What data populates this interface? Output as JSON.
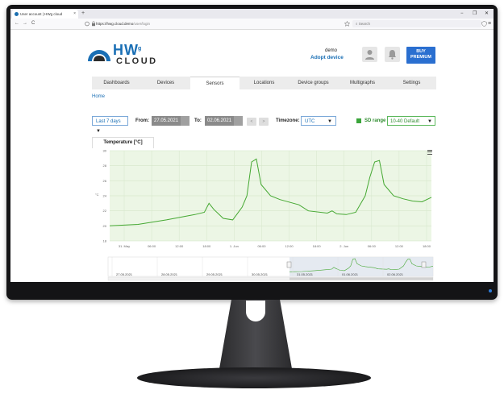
{
  "browser": {
    "tab_title": "User account | HWg cloud",
    "tab_close": "×",
    "new_tab": "+",
    "url_host": "https://hwg.cloud.demo",
    "url_path": "/user/login",
    "search_placeholder": "Search",
    "nav_back": "←",
    "nav_forward": "→",
    "nav_reload": "C",
    "win_min": "−",
    "win_max": "❐",
    "win_close": "✕"
  },
  "header": {
    "logo_hw": "HW",
    "logo_g": "g",
    "logo_cloud": "CLOUD",
    "user_name": "demo",
    "adopt_device": "Adopt device",
    "buy_line1": "BUY",
    "buy_line2": "PREMIUM"
  },
  "nav": {
    "items": [
      "Dashboards",
      "Devices",
      "Sensors",
      "Locations",
      "Device groups",
      "Multigraphs",
      "Settings"
    ],
    "active": "Sensors"
  },
  "breadcrumb": "Home",
  "filters": {
    "range": "Last 7 days",
    "from_label": "From:",
    "from_value": "27.05.2021",
    "to_label": "To:",
    "to_value": "02.06.2021",
    "prev": "<",
    "next": ">",
    "timezone_label": "Timezone:",
    "timezone_value": "UTC",
    "sd_label": "SD range",
    "sd_value": "10-40 Default"
  },
  "chart_tab": "Temperature [°C]",
  "colors": {
    "accent": "#1a6fb5",
    "line": "#45a832",
    "plot_bg": "#ecf6e5",
    "buy": "#2a6fd0"
  },
  "chart_data": {
    "type": "line",
    "ylabel": "°C",
    "ylim": [
      18,
      30
    ],
    "yticks": [
      18,
      20,
      22,
      24,
      26,
      28,
      30
    ],
    "xticks": [
      "31. May",
      "06:00",
      "12:00",
      "18:00",
      "1. Jun",
      "06:00",
      "12:00",
      "18:00",
      "2. Jun",
      "06:00",
      "12:00",
      "18:00"
    ],
    "grid": true,
    "legend": "none",
    "series": [
      {
        "x": [
          0,
          6,
          12,
          18,
          20,
          21,
          22,
          24,
          26,
          28,
          29,
          30,
          31,
          32,
          34,
          36,
          40,
          42,
          46,
          47,
          48,
          50,
          52,
          54,
          55,
          56,
          57,
          58,
          60,
          62,
          64,
          66,
          68
        ],
        "y": [
          20.0,
          20.2,
          20.8,
          21.5,
          21.8,
          23.0,
          22.2,
          21.0,
          20.8,
          22.5,
          24.0,
          28.5,
          28.9,
          25.5,
          24.0,
          23.5,
          22.8,
          22.0,
          21.7,
          22.0,
          21.6,
          21.5,
          21.8,
          24.0,
          26.5,
          28.5,
          28.7,
          25.5,
          24.0,
          23.6,
          23.3,
          23.2,
          23.8
        ]
      }
    ],
    "navigator": {
      "labels": [
        "27.05.2021",
        "28.05.2021",
        "29.05.2021",
        "30.05.2021",
        "31.05.2021",
        "01.06.2021",
        "02.06.2021"
      ]
    }
  }
}
